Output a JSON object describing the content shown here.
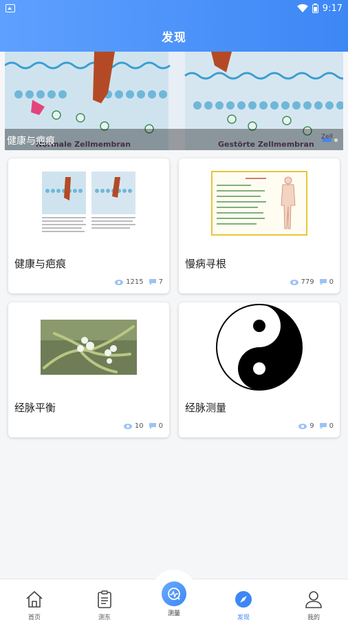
{
  "status_bar": {
    "time": "9:17"
  },
  "header": {
    "title": "发现"
  },
  "banner": {
    "caption": "健康与疤痕",
    "image_texts": [
      "Normale Zellmembran",
      "Gestörte Zellmembran",
      "Zell"
    ],
    "dot_count": 2,
    "active_dot": 0
  },
  "cards": [
    {
      "title": "健康与疤痕",
      "views": "1215",
      "comments": "7",
      "image": "cell-membrane-diagram"
    },
    {
      "title": "慢病寻根",
      "views": "779",
      "comments": "0",
      "image": "meridian-body-chart"
    },
    {
      "title": "经脉平衡",
      "views": "10",
      "comments": "0",
      "image": "mistletoe-photo"
    },
    {
      "title": "经脉测量",
      "views": "9",
      "comments": "0",
      "image": "yin-yang-symbol"
    }
  ],
  "tabbar": {
    "items": [
      {
        "label": "首页",
        "icon": "home-icon"
      },
      {
        "label": "测东",
        "icon": "clipboard-icon"
      },
      {
        "label": "测量",
        "icon": "measure-icon"
      },
      {
        "label": "发现",
        "icon": "compass-icon",
        "active": true
      },
      {
        "label": "我的",
        "icon": "user-icon"
      }
    ]
  },
  "colors": {
    "accent": "#3d87f5",
    "text": "#222222",
    "muted": "#555555"
  }
}
